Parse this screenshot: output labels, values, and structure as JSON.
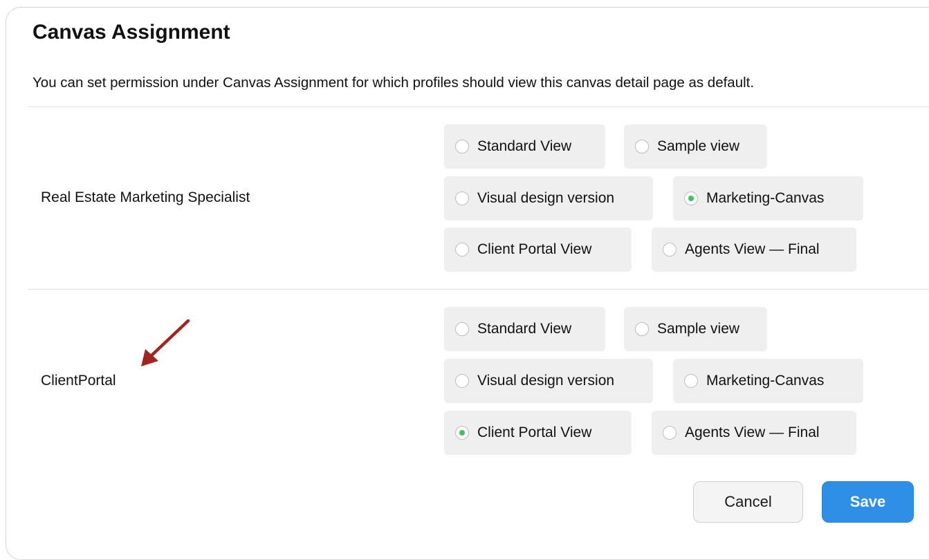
{
  "dialog": {
    "title": "Canvas Assignment",
    "description": "You can set permission under Canvas Assignment for which profiles should view this canvas detail page as default."
  },
  "profiles": [
    {
      "name": "Real Estate Marketing Specialist",
      "options": [
        {
          "label": "Standard View",
          "selected": false
        },
        {
          "label": "Sample view",
          "selected": false
        },
        {
          "label": "Visual design version",
          "selected": false
        },
        {
          "label": "Marketing-Canvas",
          "selected": true
        },
        {
          "label": "Client Portal View",
          "selected": false
        },
        {
          "label": "Agents View — Final",
          "selected": false
        }
      ]
    },
    {
      "name": "ClientPortal",
      "options": [
        {
          "label": "Standard View",
          "selected": false
        },
        {
          "label": "Sample view",
          "selected": false
        },
        {
          "label": "Visual design version",
          "selected": false
        },
        {
          "label": "Marketing-Canvas",
          "selected": false
        },
        {
          "label": "Client Portal View",
          "selected": true
        },
        {
          "label": "Agents View — Final",
          "selected": false
        }
      ]
    }
  ],
  "buttons": {
    "cancel": "Cancel",
    "save": "Save"
  },
  "colors": {
    "accent": "#2f8fe6",
    "radio_selected": "#3fc163",
    "annotation_arrow": "#a3231f"
  },
  "icons": {
    "annotation": "arrow-pointer-icon"
  }
}
